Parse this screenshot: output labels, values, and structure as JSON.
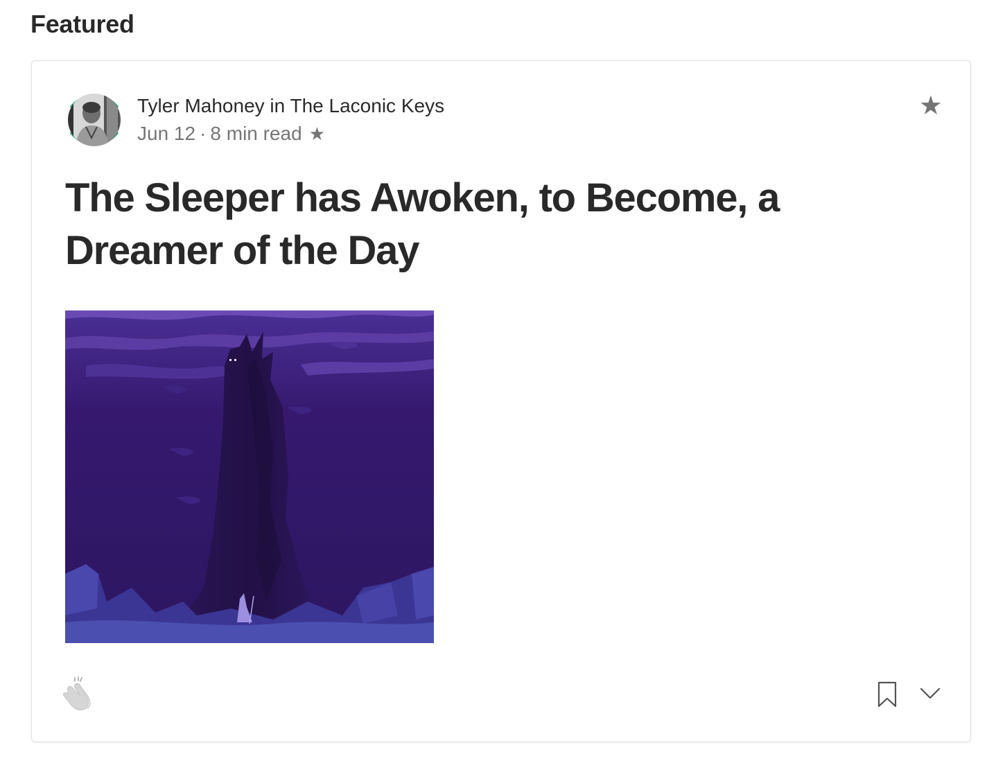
{
  "section": {
    "heading": "Featured"
  },
  "post": {
    "author": "Tyler Mahoney",
    "connector": "in",
    "publication": "The Laconic Keys",
    "date": "Jun 12",
    "separator": "·",
    "read_time": "8 min read",
    "member_star": "★",
    "title": "The Sleeper has Awoken, to Become, a Dreamer of the Day",
    "bookmark_star": "★"
  },
  "icons": {
    "avatar": "author-avatar",
    "top_star": "star-icon",
    "clap": "clap-icon",
    "bookmark": "bookmark-icon",
    "more": "chevron-down-icon"
  },
  "colors": {
    "text_primary": "#292929",
    "text_secondary": "#757575",
    "avatar_ring": "#1c9963",
    "hero_sky": "#3a1f7a",
    "hero_cloud": "#6a4bb3"
  }
}
